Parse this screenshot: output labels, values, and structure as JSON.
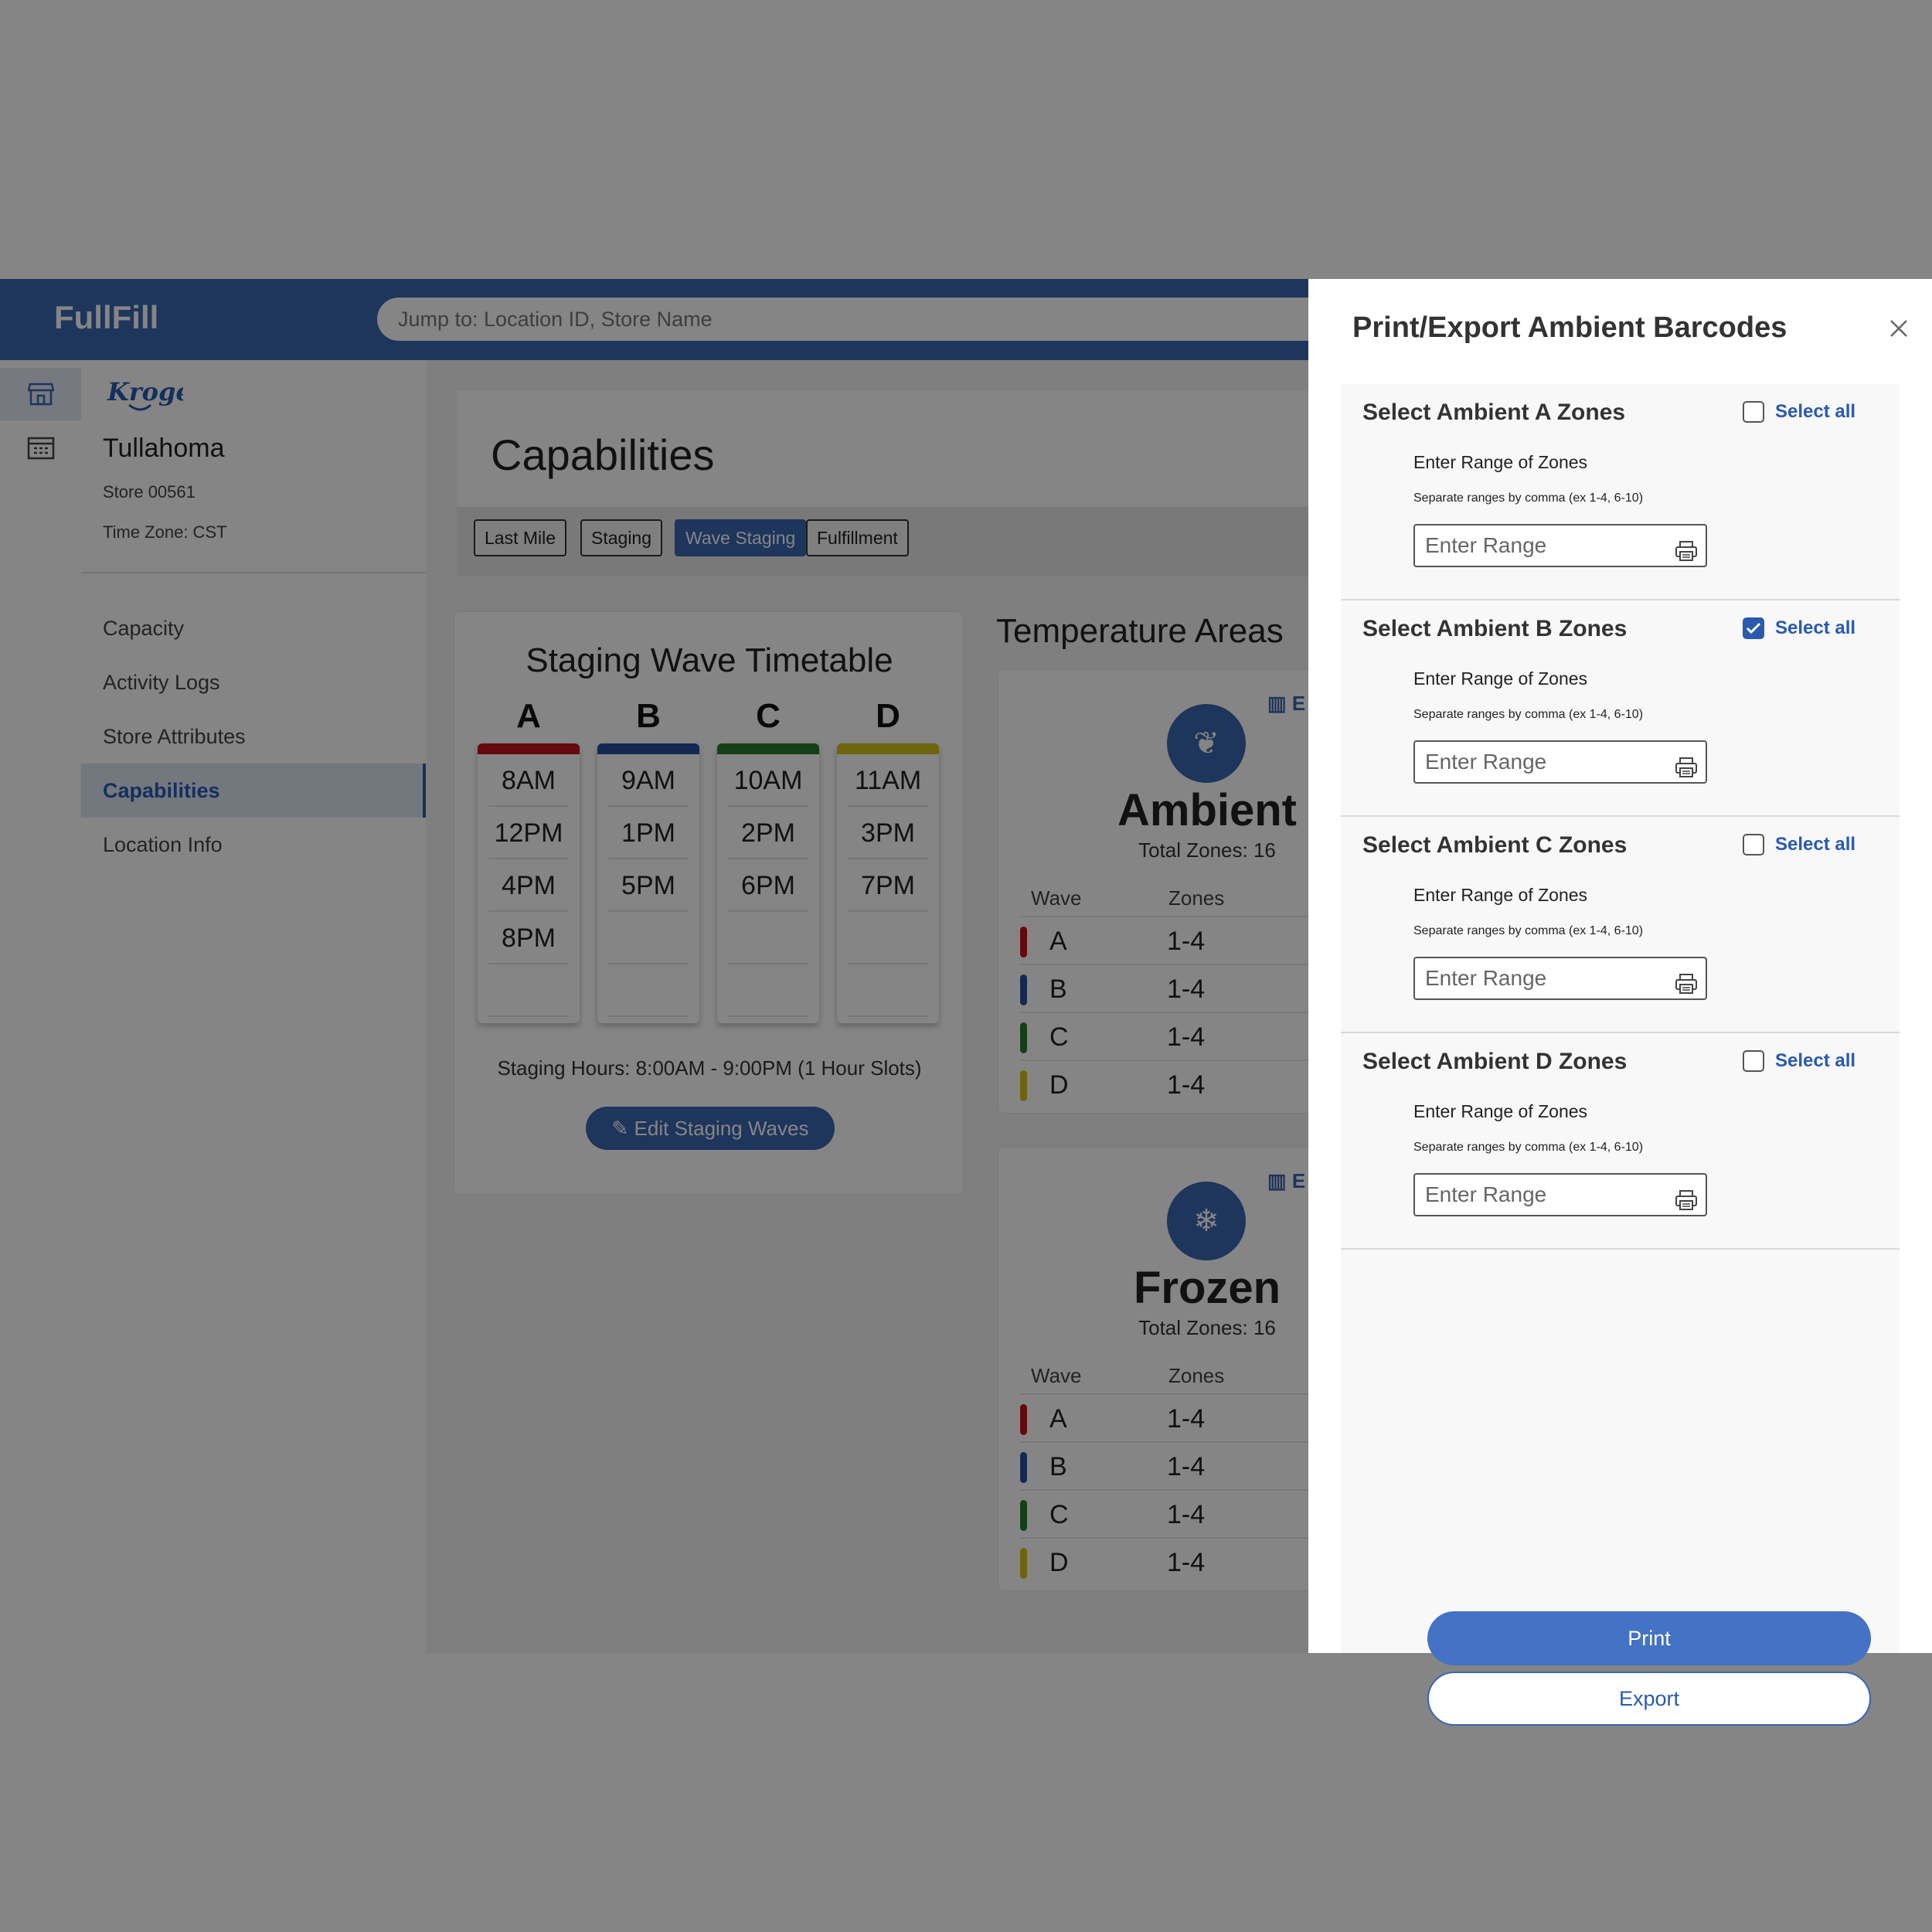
{
  "app": {
    "brand": "FullFill",
    "search_placeholder": "Jump to: Location ID, Store Name"
  },
  "store": {
    "logo_text": "Kroger",
    "name": "Tullahoma",
    "number": "Store 00561",
    "timezone": "Time Zone: CST"
  },
  "nav": [
    "Capacity",
    "Activity Logs",
    "Store Attributes",
    "Capabilities",
    "Location Info"
  ],
  "page": {
    "title": "Capabilities",
    "tabs": [
      "Last Mile",
      "Staging",
      "Wave Staging",
      "Fulfillment"
    ],
    "active_tab": "Wave Staging"
  },
  "timetable": {
    "title": "Staging Wave Timetable",
    "columns": [
      {
        "label": "A",
        "color": "#c0121a",
        "slots": [
          "8AM",
          "12PM",
          "4PM",
          "8PM"
        ]
      },
      {
        "label": "B",
        "color": "#2a4ea0",
        "slots": [
          "9AM",
          "1PM",
          "5PM"
        ]
      },
      {
        "label": "C",
        "color": "#2c7a2c",
        "slots": [
          "10AM",
          "2PM",
          "6PM"
        ]
      },
      {
        "label": "D",
        "color": "#d2c01a",
        "slots": [
          "11AM",
          "3PM",
          "7PM"
        ]
      }
    ],
    "hours": "Staging Hours: 8:00AM - 9:00PM (1 Hour Slots)",
    "edit_button": "Edit Staging Waves"
  },
  "temperature": {
    "title": "Temperature Areas",
    "link_text": "E",
    "header_wave": "Wave",
    "header_zones": "Zones",
    "areas": [
      {
        "name": "Ambient",
        "icon": "leaf-icon",
        "total": "Total Zones: 16",
        "rows": [
          {
            "wave": "A",
            "zones": "1-4"
          },
          {
            "wave": "B",
            "zones": "1-4"
          },
          {
            "wave": "C",
            "zones": "1-4"
          },
          {
            "wave": "D",
            "zones": "1-4"
          }
        ]
      },
      {
        "name": "Frozen",
        "icon": "snowflake-icon",
        "total": "Total Zones: 16",
        "rows": [
          {
            "wave": "A",
            "zones": "1-4"
          },
          {
            "wave": "B",
            "zones": "1-4"
          },
          {
            "wave": "C",
            "zones": "1-4"
          },
          {
            "wave": "D",
            "zones": "1-4"
          }
        ]
      }
    ]
  },
  "drawer": {
    "title": "Print/Export Ambient Barcodes",
    "select_all": "Select all",
    "range_label": "Enter Range of Zones",
    "range_hint": "Separate ranges by comma (ex 1-4, 6-10)",
    "range_placeholder": "Enter Range",
    "sections": [
      {
        "title": "Select Ambient A Zones",
        "checked": false
      },
      {
        "title": "Select Ambient B Zones",
        "checked": true
      },
      {
        "title": "Select Ambient C Zones",
        "checked": false
      },
      {
        "title": "Select Ambient D Zones",
        "checked": false
      }
    ],
    "print_label": "Print",
    "export_label": "Export"
  },
  "colors": {
    "primary": "#3a66b1",
    "wave_a": "#c0121a",
    "wave_b": "#2a4ea0",
    "wave_c": "#2c7a2c",
    "wave_d": "#d2c01a"
  }
}
